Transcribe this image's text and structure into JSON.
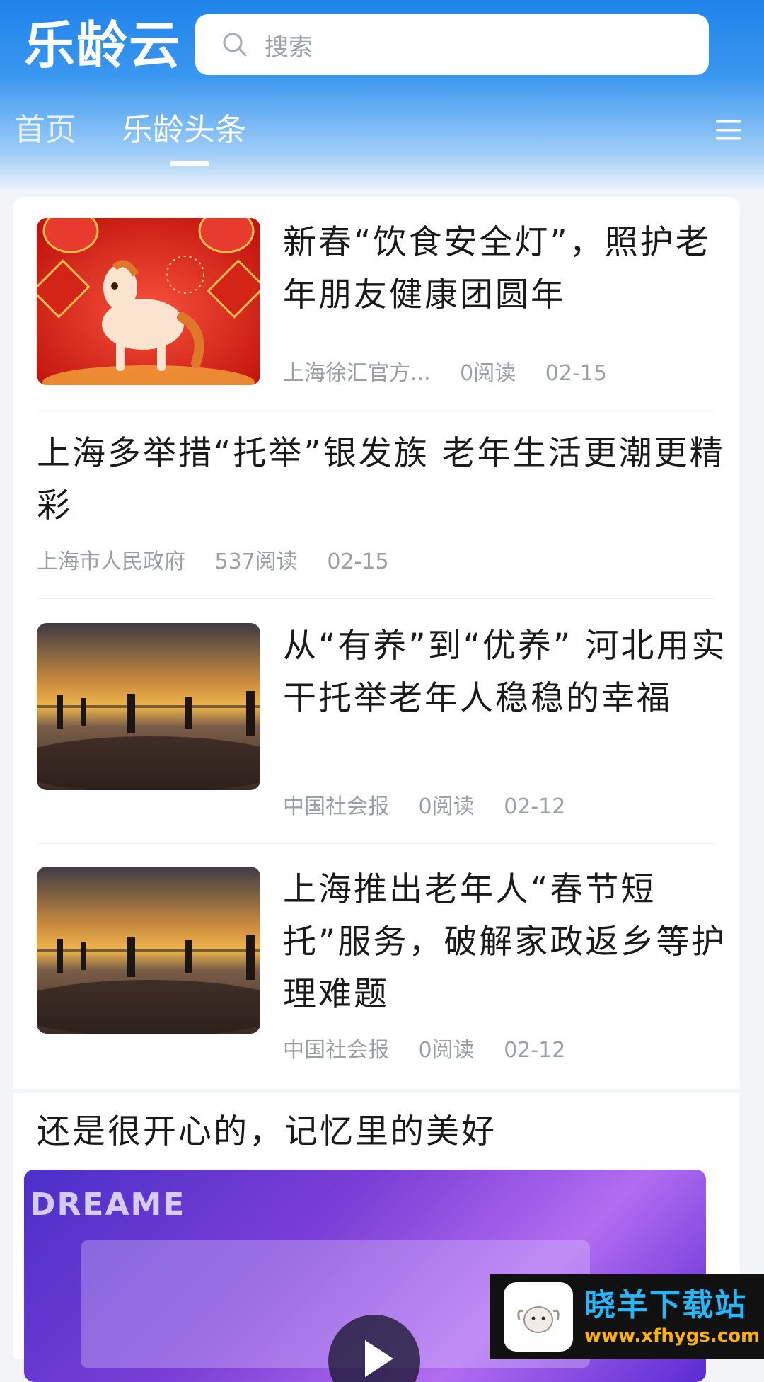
{
  "header": {
    "logo": "乐龄云",
    "search_placeholder": "搜索",
    "tabs": [
      {
        "label": "首页"
      },
      {
        "label": "乐龄头条"
      }
    ],
    "active_tab": "乐龄头条"
  },
  "articles": [
    {
      "title": "新春“饮食安全灯”，照护老年朋友健康团圆年",
      "source": "上海徐汇官方...",
      "reads": "0阅读",
      "date": "02-15",
      "image": "new-year-horse-illustration"
    },
    {
      "title": "上海多举措“托举”银发族 老年生活更潮更精彩",
      "source": "上海市人民政府",
      "reads": "537阅读",
      "date": "02-15"
    },
    {
      "title": "从“有养”到“优养” 河北用实干托举老年人稳稳的幸福",
      "source": "中国社会报",
      "reads": "0阅读",
      "date": "02-12",
      "image": "sunset-beach-photo"
    },
    {
      "title": "上海推出老年人“春节短托”服务，破解家政返乡等护理难题",
      "source": "中国社会报",
      "reads": "0阅读",
      "date": "02-12",
      "image": "sunset-beach-photo"
    }
  ],
  "video_post": {
    "title": "还是很开心的，记忆里的美好",
    "video_text": "DREAME"
  },
  "watermark": {
    "name": "晓羊下载站",
    "url": "www.xfhygs.com"
  },
  "colors": {
    "header_blue": "#1f83ea",
    "text_primary": "#1a1a1a",
    "text_meta": "#9b9ea4"
  }
}
